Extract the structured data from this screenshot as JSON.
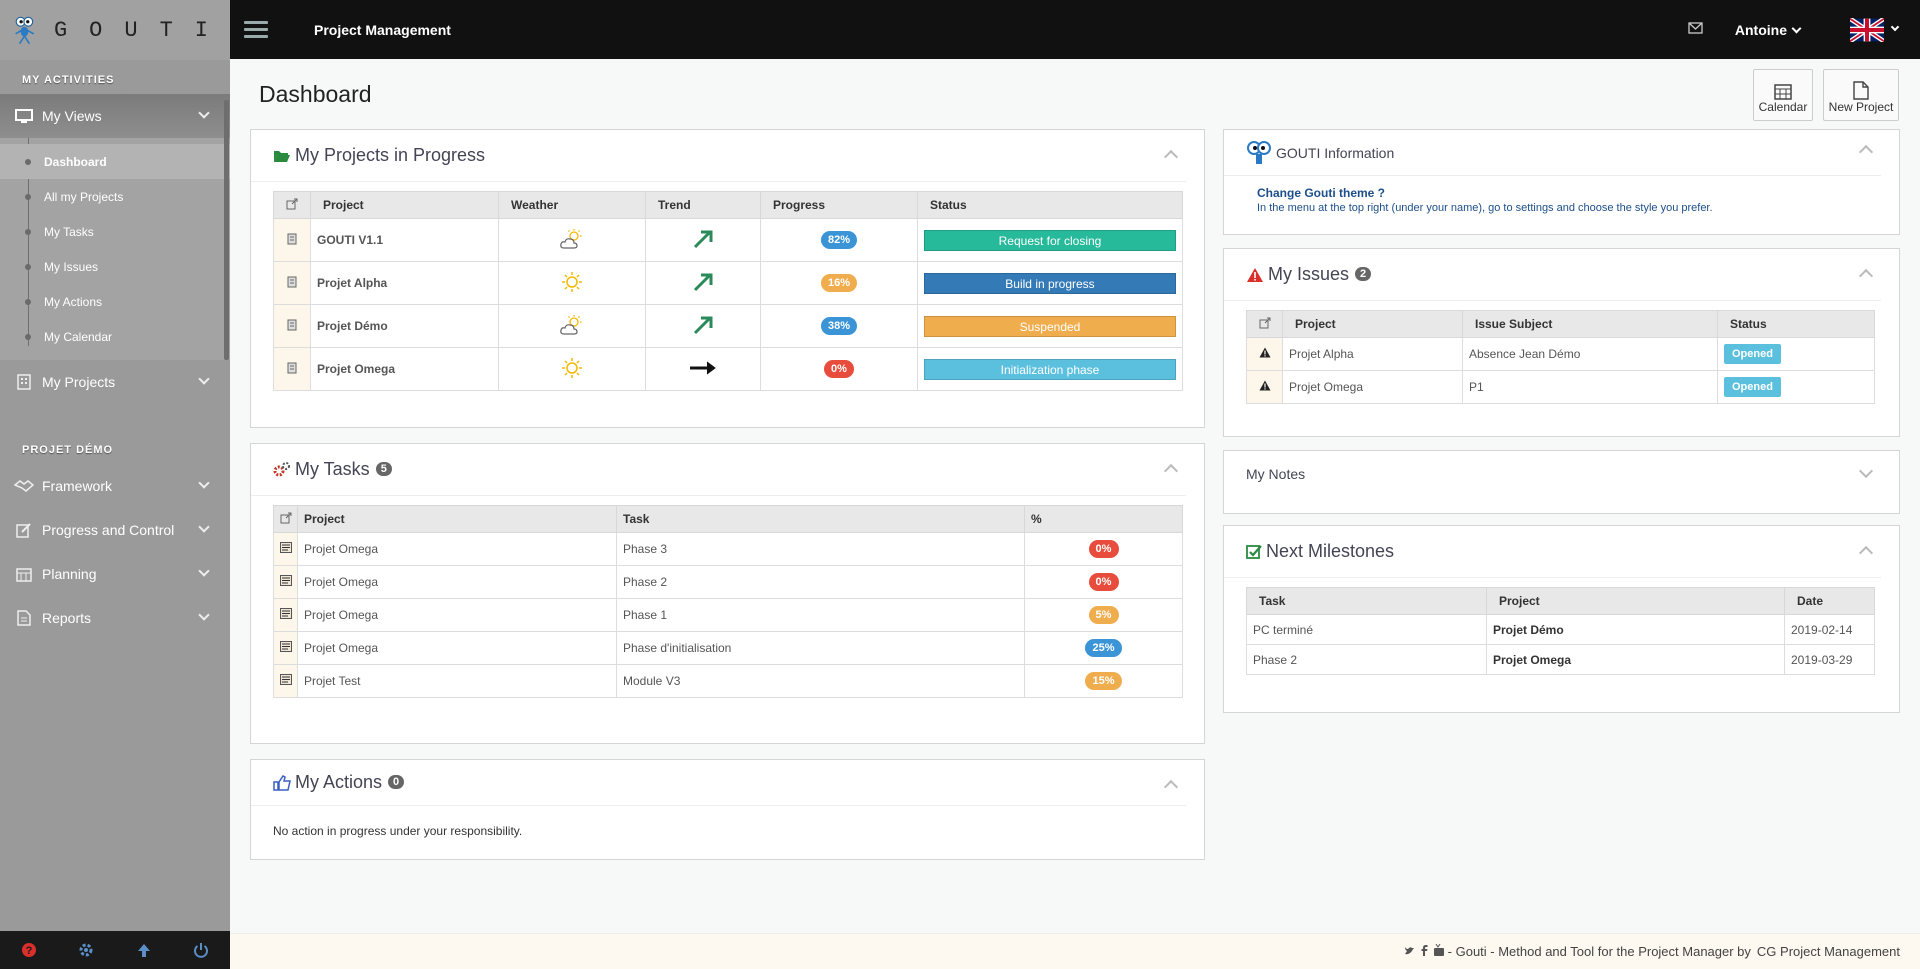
{
  "app": {
    "brand": "GOUTI",
    "title": "Project Management"
  },
  "topbar": {
    "user": "Antoine",
    "mail_icon": "envelope-icon",
    "flag_icon": "uk-flag-icon"
  },
  "sidebar": {
    "section1": "MY ACTIVITIES",
    "my_views": "My Views",
    "views_items": [
      "Dashboard",
      "All my Projects",
      "My Tasks",
      "My Issues",
      "My Actions",
      "My Calendar"
    ],
    "my_projects": "My Projects",
    "section2": "PROJET DÉMO",
    "project_items": [
      "Framework",
      "Progress and Control",
      "Planning",
      "Reports"
    ]
  },
  "page": {
    "title": "Dashboard",
    "calendar_btn": "Calendar",
    "new_project_btn": "New Project"
  },
  "projects_panel": {
    "title": "My Projects in Progress",
    "headers": [
      "Project",
      "Weather",
      "Trend",
      "Progress",
      "Status"
    ],
    "rows": [
      {
        "project": "GOUTI V1.1",
        "weather": "sun-cloud",
        "trend": "up",
        "progress": "82%",
        "progress_color": "#3a94d6",
        "status": "Request for closing",
        "status_color": "#26b99a"
      },
      {
        "project": "Projet Alpha",
        "weather": "sun",
        "trend": "up",
        "progress": "16%",
        "progress_color": "#f0ad4e",
        "status": "Build in progress",
        "status_color": "#337ab7"
      },
      {
        "project": "Projet Démo",
        "weather": "sun-cloud",
        "trend": "up",
        "progress": "38%",
        "progress_color": "#3a94d6",
        "status": "Suspended",
        "status_color": "#f0ad4e"
      },
      {
        "project": "Projet Omega",
        "weather": "sun",
        "trend": "flat",
        "progress": "0%",
        "progress_color": "#e74c3c",
        "status": "Initialization phase",
        "status_color": "#5bc0de"
      }
    ]
  },
  "tasks_panel": {
    "title": "My Tasks",
    "count": "5",
    "headers": [
      "Project",
      "Task",
      "%"
    ],
    "rows": [
      {
        "project": "Projet Omega",
        "task": "Phase 3",
        "pct": "0%",
        "color": "#e74c3c"
      },
      {
        "project": "Projet Omega",
        "task": "Phase 2",
        "pct": "0%",
        "color": "#e74c3c"
      },
      {
        "project": "Projet Omega",
        "task": "Phase 1",
        "pct": "5%",
        "color": "#f0ad4e"
      },
      {
        "project": "Projet Omega",
        "task": "Phase d'initialisation",
        "pct": "25%",
        "color": "#3a94d6"
      },
      {
        "project": "Projet Test",
        "task": "Module V3",
        "pct": "15%",
        "color": "#f0ad4e"
      }
    ]
  },
  "actions_panel": {
    "title": "My Actions",
    "count": "0",
    "empty_text": "No action in progress under your responsibility."
  },
  "info_panel": {
    "title": "GOUTI Information",
    "question": "Change Gouti theme ?",
    "answer": "In the menu at the top right (under your name), go to settings and choose the style you prefer."
  },
  "issues_panel": {
    "title": "My Issues",
    "count": "2",
    "headers": [
      "Project",
      "Issue Subject",
      "Status"
    ],
    "rows": [
      {
        "project": "Projet Alpha",
        "subject": "Absence Jean Démo",
        "status": "Opened"
      },
      {
        "project": "Projet Omega",
        "subject": "P1",
        "status": "Opened"
      }
    ]
  },
  "notes_panel": {
    "title": "My Notes"
  },
  "milestones_panel": {
    "title": "Next Milestones",
    "headers": [
      "Task",
      "Project",
      "Date"
    ],
    "rows": [
      {
        "task": "PC terminé",
        "project": "Projet Démo",
        "date": "2019-02-14"
      },
      {
        "task": "Phase 2",
        "project": "Projet Omega",
        "date": "2019-03-29"
      }
    ]
  },
  "footer": {
    "text": "- Gouti - Method and Tool for the Project Manager by",
    "link": "CG Project Management"
  }
}
